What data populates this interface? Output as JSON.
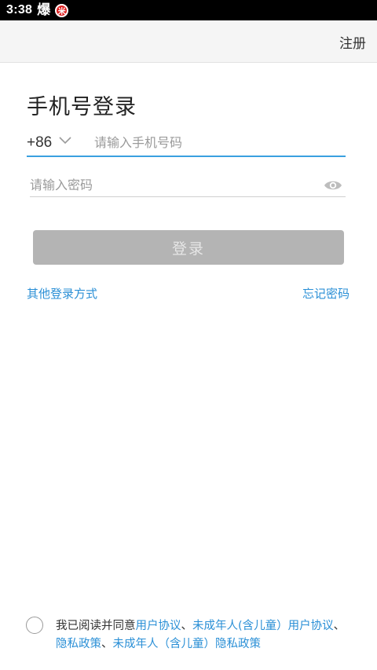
{
  "status_bar": {
    "time": "3:38",
    "app_glyph": "爆",
    "notif_glyph": "米"
  },
  "header": {
    "register_label": "注册"
  },
  "login": {
    "title": "手机号登录",
    "country_code": "+86",
    "phone_placeholder": "请输入手机号码",
    "password_placeholder": "请输入密码",
    "submit_label": "登录",
    "other_methods_label": "其他登录方式",
    "forgot_password_label": "忘记密码"
  },
  "agreement": {
    "prefix": "我已阅读并同意",
    "user_agreement": "用户协议",
    "sep1": "、",
    "minor_user_agreement": "未成年人(含儿童）用户协议",
    "sep2": "、",
    "privacy_policy": "隐私政策",
    "sep3": "、",
    "minor_privacy_policy": "未成年人（含儿童）隐私政策"
  },
  "colors": {
    "accent": "#2a8fd6",
    "input_focus": "#3aa0e0",
    "button_disabled": "#b4b4b4"
  }
}
